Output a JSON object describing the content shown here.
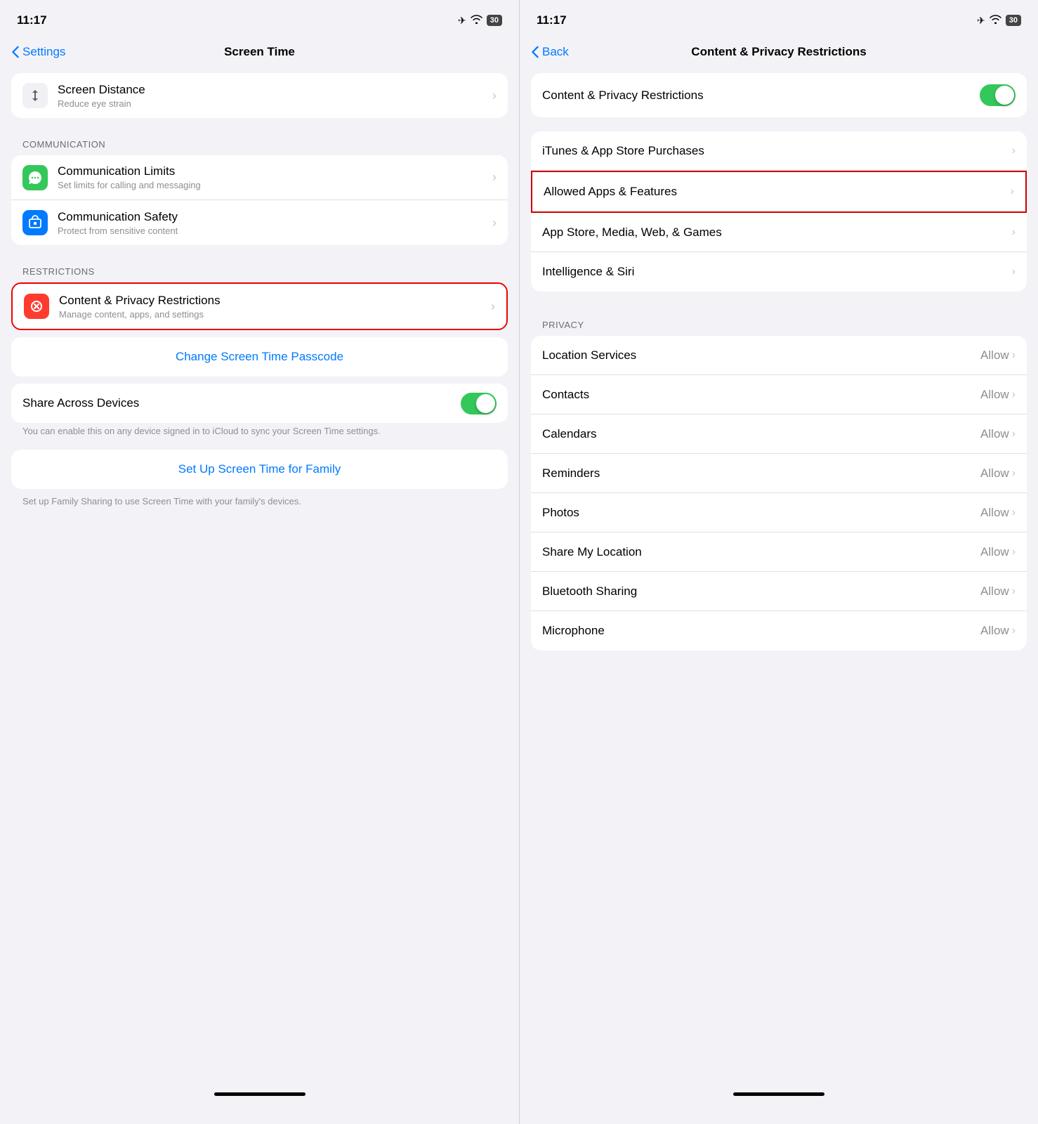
{
  "left": {
    "status": {
      "time": "11:17",
      "icons": [
        "✈",
        "wifi",
        "30"
      ]
    },
    "nav": {
      "back_label": "Settings",
      "title": "Screen Time"
    },
    "screen_distance": {
      "title": "Screen Distance",
      "subtitle": "Reduce eye strain"
    },
    "section_communication": "COMMUNICATION",
    "communication_limits": {
      "title": "Communication Limits",
      "subtitle": "Set limits for calling and messaging"
    },
    "communication_safety": {
      "title": "Communication Safety",
      "subtitle": "Protect from sensitive content"
    },
    "section_restrictions": "RESTRICTIONS",
    "content_privacy": {
      "title": "Content & Privacy Restrictions",
      "subtitle": "Manage content, apps, and settings"
    },
    "passcode_btn": "Change Screen Time Passcode",
    "share_across": {
      "title": "Share Across Devices",
      "note": "You can enable this on any device signed in to iCloud to sync your Screen Time settings."
    },
    "setup_family_btn": "Set Up Screen Time for Family",
    "setup_family_note": "Set up Family Sharing to use Screen Time with your family's devices."
  },
  "right": {
    "status": {
      "time": "11:17",
      "icons": [
        "✈",
        "wifi",
        "30"
      ]
    },
    "nav": {
      "back_label": "Back",
      "title": "Content & Privacy Restrictions"
    },
    "toggle_title": "Content & Privacy Restrictions",
    "items_top": [
      {
        "label": "iTunes & App Store Purchases",
        "value": ""
      },
      {
        "label": "Allowed Apps & Features",
        "value": "",
        "highlighted": true
      },
      {
        "label": "App Store, Media, Web, & Games",
        "value": ""
      },
      {
        "label": "Intelligence & Siri",
        "value": ""
      }
    ],
    "section_privacy": "PRIVACY",
    "privacy_items": [
      {
        "label": "Location Services",
        "value": "Allow"
      },
      {
        "label": "Contacts",
        "value": "Allow"
      },
      {
        "label": "Calendars",
        "value": "Allow"
      },
      {
        "label": "Reminders",
        "value": "Allow"
      },
      {
        "label": "Photos",
        "value": "Allow"
      },
      {
        "label": "Share My Location",
        "value": "Allow"
      },
      {
        "label": "Bluetooth Sharing",
        "value": "Allow"
      },
      {
        "label": "Microphone",
        "value": "Allow"
      }
    ]
  }
}
